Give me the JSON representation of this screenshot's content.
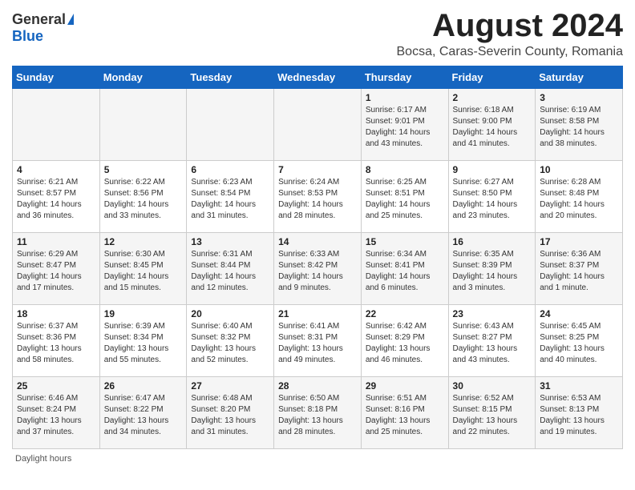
{
  "header": {
    "logo_general": "General",
    "logo_blue": "Blue",
    "main_title": "August 2024",
    "subtitle": "Bocsa, Caras-Severin County, Romania"
  },
  "calendar": {
    "columns": [
      "Sunday",
      "Monday",
      "Tuesday",
      "Wednesday",
      "Thursday",
      "Friday",
      "Saturday"
    ],
    "rows": [
      [
        {
          "day": "",
          "info": ""
        },
        {
          "day": "",
          "info": ""
        },
        {
          "day": "",
          "info": ""
        },
        {
          "day": "",
          "info": ""
        },
        {
          "day": "1",
          "info": "Sunrise: 6:17 AM\nSunset: 9:01 PM\nDaylight: 14 hours\nand 43 minutes."
        },
        {
          "day": "2",
          "info": "Sunrise: 6:18 AM\nSunset: 9:00 PM\nDaylight: 14 hours\nand 41 minutes."
        },
        {
          "day": "3",
          "info": "Sunrise: 6:19 AM\nSunset: 8:58 PM\nDaylight: 14 hours\nand 38 minutes."
        }
      ],
      [
        {
          "day": "4",
          "info": "Sunrise: 6:21 AM\nSunset: 8:57 PM\nDaylight: 14 hours\nand 36 minutes."
        },
        {
          "day": "5",
          "info": "Sunrise: 6:22 AM\nSunset: 8:56 PM\nDaylight: 14 hours\nand 33 minutes."
        },
        {
          "day": "6",
          "info": "Sunrise: 6:23 AM\nSunset: 8:54 PM\nDaylight: 14 hours\nand 31 minutes."
        },
        {
          "day": "7",
          "info": "Sunrise: 6:24 AM\nSunset: 8:53 PM\nDaylight: 14 hours\nand 28 minutes."
        },
        {
          "day": "8",
          "info": "Sunrise: 6:25 AM\nSunset: 8:51 PM\nDaylight: 14 hours\nand 25 minutes."
        },
        {
          "day": "9",
          "info": "Sunrise: 6:27 AM\nSunset: 8:50 PM\nDaylight: 14 hours\nand 23 minutes."
        },
        {
          "day": "10",
          "info": "Sunrise: 6:28 AM\nSunset: 8:48 PM\nDaylight: 14 hours\nand 20 minutes."
        }
      ],
      [
        {
          "day": "11",
          "info": "Sunrise: 6:29 AM\nSunset: 8:47 PM\nDaylight: 14 hours\nand 17 minutes."
        },
        {
          "day": "12",
          "info": "Sunrise: 6:30 AM\nSunset: 8:45 PM\nDaylight: 14 hours\nand 15 minutes."
        },
        {
          "day": "13",
          "info": "Sunrise: 6:31 AM\nSunset: 8:44 PM\nDaylight: 14 hours\nand 12 minutes."
        },
        {
          "day": "14",
          "info": "Sunrise: 6:33 AM\nSunset: 8:42 PM\nDaylight: 14 hours\nand 9 minutes."
        },
        {
          "day": "15",
          "info": "Sunrise: 6:34 AM\nSunset: 8:41 PM\nDaylight: 14 hours\nand 6 minutes."
        },
        {
          "day": "16",
          "info": "Sunrise: 6:35 AM\nSunset: 8:39 PM\nDaylight: 14 hours\nand 3 minutes."
        },
        {
          "day": "17",
          "info": "Sunrise: 6:36 AM\nSunset: 8:37 PM\nDaylight: 14 hours\nand 1 minute."
        }
      ],
      [
        {
          "day": "18",
          "info": "Sunrise: 6:37 AM\nSunset: 8:36 PM\nDaylight: 13 hours\nand 58 minutes."
        },
        {
          "day": "19",
          "info": "Sunrise: 6:39 AM\nSunset: 8:34 PM\nDaylight: 13 hours\nand 55 minutes."
        },
        {
          "day": "20",
          "info": "Sunrise: 6:40 AM\nSunset: 8:32 PM\nDaylight: 13 hours\nand 52 minutes."
        },
        {
          "day": "21",
          "info": "Sunrise: 6:41 AM\nSunset: 8:31 PM\nDaylight: 13 hours\nand 49 minutes."
        },
        {
          "day": "22",
          "info": "Sunrise: 6:42 AM\nSunset: 8:29 PM\nDaylight: 13 hours\nand 46 minutes."
        },
        {
          "day": "23",
          "info": "Sunrise: 6:43 AM\nSunset: 8:27 PM\nDaylight: 13 hours\nand 43 minutes."
        },
        {
          "day": "24",
          "info": "Sunrise: 6:45 AM\nSunset: 8:25 PM\nDaylight: 13 hours\nand 40 minutes."
        }
      ],
      [
        {
          "day": "25",
          "info": "Sunrise: 6:46 AM\nSunset: 8:24 PM\nDaylight: 13 hours\nand 37 minutes."
        },
        {
          "day": "26",
          "info": "Sunrise: 6:47 AM\nSunset: 8:22 PM\nDaylight: 13 hours\nand 34 minutes."
        },
        {
          "day": "27",
          "info": "Sunrise: 6:48 AM\nSunset: 8:20 PM\nDaylight: 13 hours\nand 31 minutes."
        },
        {
          "day": "28",
          "info": "Sunrise: 6:50 AM\nSunset: 8:18 PM\nDaylight: 13 hours\nand 28 minutes."
        },
        {
          "day": "29",
          "info": "Sunrise: 6:51 AM\nSunset: 8:16 PM\nDaylight: 13 hours\nand 25 minutes."
        },
        {
          "day": "30",
          "info": "Sunrise: 6:52 AM\nSunset: 8:15 PM\nDaylight: 13 hours\nand 22 minutes."
        },
        {
          "day": "31",
          "info": "Sunrise: 6:53 AM\nSunset: 8:13 PM\nDaylight: 13 hours\nand 19 minutes."
        }
      ]
    ]
  },
  "footer": {
    "daylight_label": "Daylight hours"
  }
}
